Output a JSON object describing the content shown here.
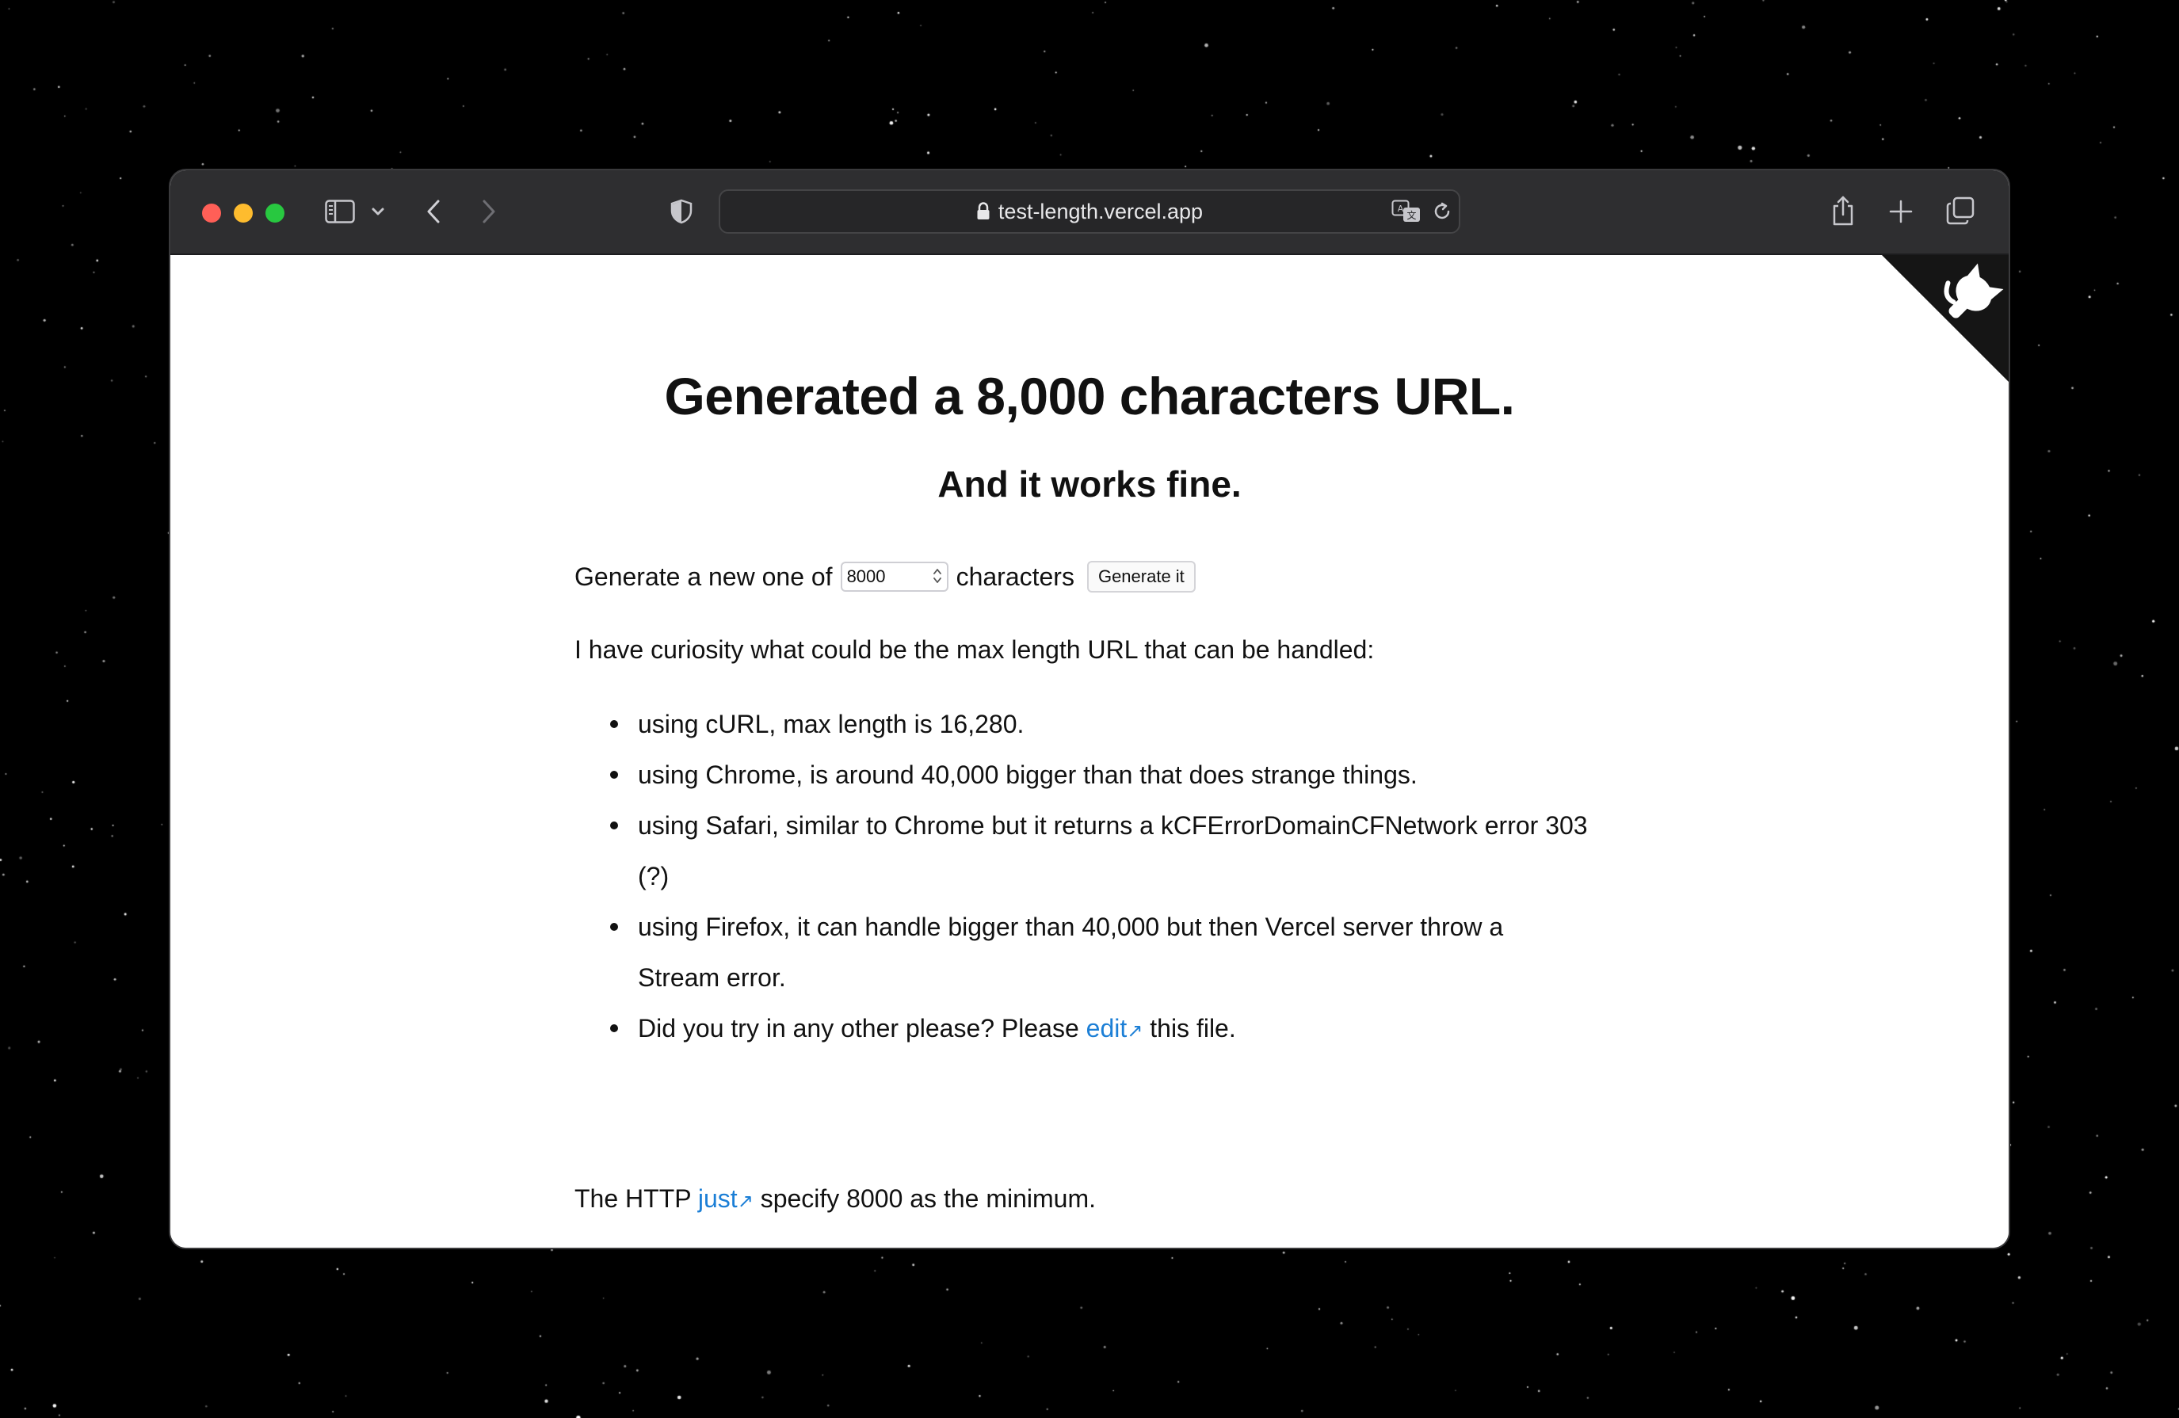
{
  "browser": {
    "url": "test-length.vercel.app"
  },
  "page": {
    "title": "Generated a 8,000 characters URL.",
    "subtitle": "And it works fine.",
    "generate_prefix": "Generate a new one of",
    "length_value": "8000",
    "generate_suffix": "characters",
    "generate_button": "Generate it",
    "intro": "I have curiosity what could be the max length URL that can be handled:",
    "list": {
      "item1": "using cURL, max length is 16,280.",
      "item2": "using Chrome, is around 40,000 bigger than that does strange things.",
      "item3_line1": "using Safari, similar to Chrome but it returns a kCFErrorDomainCFNetwork error 303",
      "item3_line2": "(?)",
      "item4_line1": "using Firefox, it can handle bigger than 40,000 but then Vercel server throw a",
      "item4_line2": "Stream error.",
      "item5_before": "Did you try in any other please? Please",
      "item5_link": "edit",
      "item5_after": "this file."
    },
    "footer_before": "The HTTP",
    "footer_link": "just",
    "footer_after": "specify 8000 as the minimum.",
    "ext_arrow": "↗"
  },
  "colors": {
    "link": "#1c7fd6",
    "close": "#ff5f57",
    "minimize": "#febc2e",
    "zoom": "#28c840"
  },
  "icons": [
    "sidebar-icon",
    "chevron-down-icon",
    "back-icon",
    "forward-icon",
    "privacy-shield-icon",
    "lock-icon",
    "translate-icon",
    "reload-icon",
    "share-icon",
    "new-tab-icon",
    "tab-overview-icon",
    "github-octocat-icon"
  ]
}
